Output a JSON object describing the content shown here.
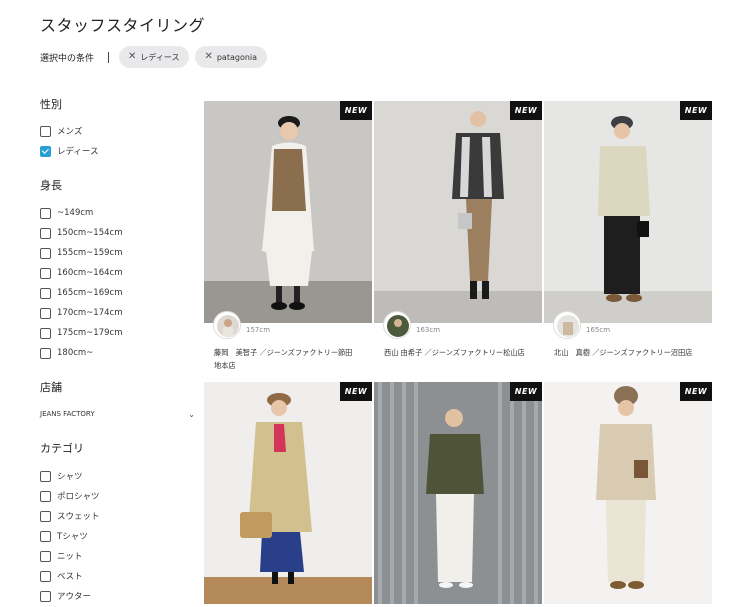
{
  "page_title": "スタッフスタイリング",
  "conditions": {
    "label": "選択中の条件",
    "chips": [
      "レディース",
      "patagonia"
    ]
  },
  "filters": {
    "gender": {
      "title": "性別",
      "options": [
        {
          "label": "メンズ",
          "checked": false
        },
        {
          "label": "レディース",
          "checked": true
        }
      ]
    },
    "height": {
      "title": "身長",
      "options": [
        "~149cm",
        "150cm~154cm",
        "155cm~159cm",
        "160cm~164cm",
        "165cm~169cm",
        "170cm~174cm",
        "175cm~179cm",
        "180cm~"
      ]
    },
    "store": {
      "title": "店舗",
      "selected": "JEANS FACTORY"
    },
    "category": {
      "title": "カテゴリ",
      "options": [
        "シャツ",
        "ポロシャツ",
        "スウェット",
        "Tシャツ",
        "ニット",
        "ベスト",
        "アウター"
      ]
    }
  },
  "badge_label": "NEW",
  "cards": [
    {
      "height": "157cm",
      "staff": "藤岡　美智子 ／ジーンズファクトリー節田",
      "staff2": "地本店",
      "icon": "outfit-photo"
    },
    {
      "height": "163cm",
      "staff": "西山 由希子 ／ジーンズファクトリー松山店",
      "staff2": "",
      "icon": "outfit-photo"
    },
    {
      "height": "165cm",
      "staff": "北山　真樹 ／ジーンズファクトリー沼田店",
      "staff2": "",
      "icon": "outfit-photo"
    },
    {
      "height": "",
      "staff": "",
      "staff2": "",
      "icon": "outfit-photo"
    },
    {
      "height": "",
      "staff": "",
      "staff2": "",
      "icon": "outfit-photo"
    },
    {
      "height": "",
      "staff": "",
      "staff2": "",
      "icon": "outfit-photo"
    }
  ],
  "colors": {
    "checkbox_checked": "#2a9fd6",
    "chip_bg": "#e9e9eb",
    "badge_bg": "#111111"
  }
}
